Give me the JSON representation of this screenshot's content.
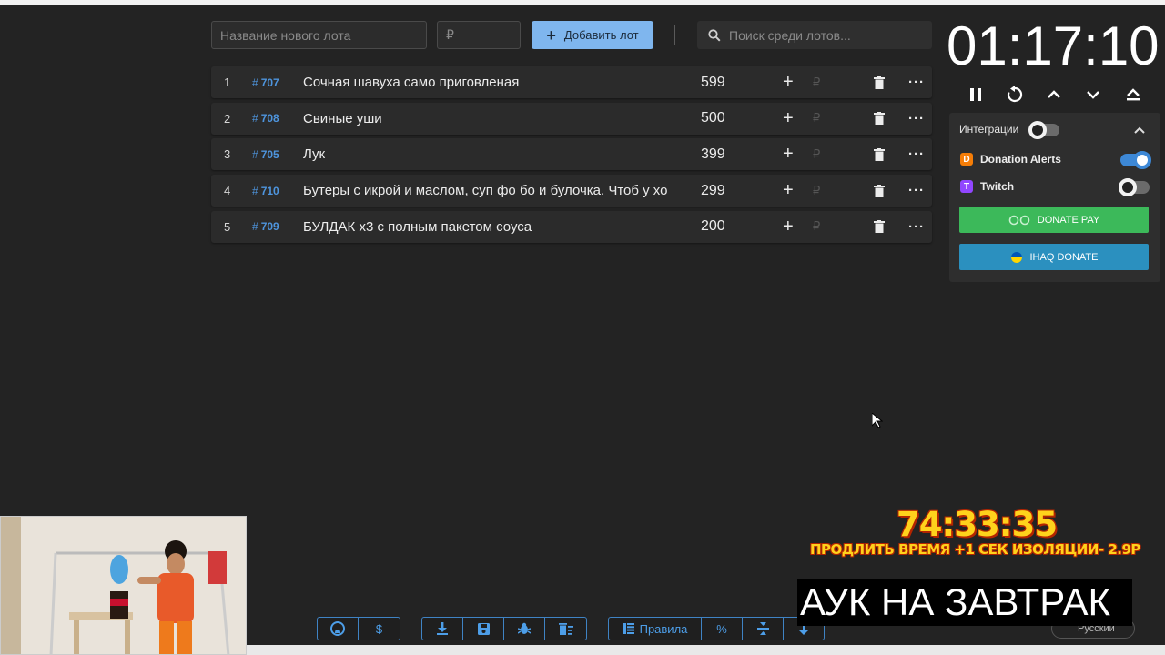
{
  "inputs": {
    "lot_name_placeholder": "Название нового лота",
    "price_placeholder": "₽",
    "add_button": "Добавить лот",
    "search_placeholder": "Поиск среди лотов..."
  },
  "lots": [
    {
      "num": "1",
      "id": "707",
      "title": "Сочная шавуха само приговленая",
      "amount": "599"
    },
    {
      "num": "2",
      "id": "708",
      "title": "Свиные уши",
      "amount": "500"
    },
    {
      "num": "3",
      "id": "705",
      "title": "Лук",
      "amount": "399"
    },
    {
      "num": "4",
      "id": "710",
      "title": "Бутеры с икрой и маслом, суп фо бо и булочка. Чтоб у хо",
      "amount": "299"
    },
    {
      "num": "5",
      "id": "709",
      "title": "БУЛДАК х3 с полным пакетом соуса",
      "amount": "200"
    }
  ],
  "lot_hash": "#",
  "lot_rub": "₽",
  "timer": "01:17:10",
  "integrations": {
    "title": "Интеграции",
    "donation_alerts": "Donation Alerts",
    "twitch": "Twitch",
    "donate_pay": "DONATE PAY",
    "ihaq_donate": "IHAQ DONATE",
    "donation_alerts_on": true,
    "twitch_on": false,
    "integrations_on": false
  },
  "toolbar": {
    "rules": "Правила",
    "percent": "%",
    "dollar": "$"
  },
  "stream_overlay": {
    "timer": "74:33:35",
    "subtitle": "ПРОДЛИТЬ ВРЕМЯ +1 СЕК ИЗОЛЯЦИИ- 2.9Р",
    "banner": "АУК НА ЗАВТРАК"
  },
  "language": "Русский",
  "colors": {
    "accent": "#7fb6ee",
    "lot_id": "#4e95de",
    "donate_pay": "#3cb95a",
    "ihaq": "#2b90bf",
    "overlay_yellow": "#ffd21c"
  }
}
